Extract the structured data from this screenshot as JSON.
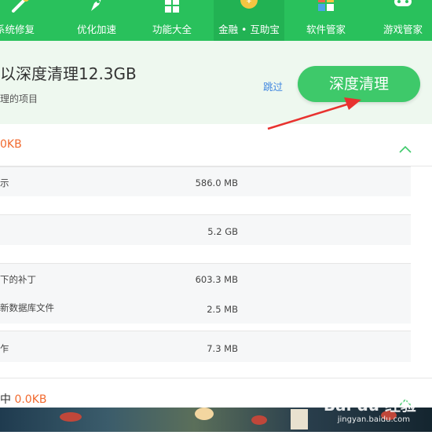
{
  "nav": {
    "items": [
      {
        "label": "系统修复",
        "icon": "wrench-icon"
      },
      {
        "label": "优化加速",
        "icon": "rocket-icon"
      },
      {
        "label": "功能大全",
        "icon": "grid-icon"
      },
      {
        "label": "金融 • 互助宝",
        "icon": "coin-icon"
      },
      {
        "label": "软件管家",
        "icon": "software-icon"
      },
      {
        "label": "游戏管家",
        "icon": "gamepad-icon"
      }
    ]
  },
  "header": {
    "title": "以深度清理12.3GB",
    "subtitle": "理的项目",
    "skip_label": "跳过",
    "deep_clean_label": "深度清理"
  },
  "sections": [
    {
      "size": "0KB"
    },
    {
      "size_prefix": "中",
      "size": "0.0KB"
    }
  ],
  "rows": [
    {
      "label": "示",
      "value": "586.0 MB"
    },
    {
      "label": "",
      "value": "5.2 GB"
    },
    {
      "label": "下的补丁",
      "value": "603.3 MB"
    },
    {
      "label": "新数据库文件",
      "value": "2.5 MB"
    },
    {
      "label": "乍",
      "value": "7.3 MB"
    }
  ],
  "watermark": {
    "brand": "Bai du 经验",
    "url": "jingyan.baidu.com"
  },
  "colors": {
    "nav_green": "#29c15c",
    "button_green": "#3ec96a",
    "size_orange": "#f16a2f",
    "link_blue": "#3f86e0",
    "arrow_red": "#e8322f"
  }
}
